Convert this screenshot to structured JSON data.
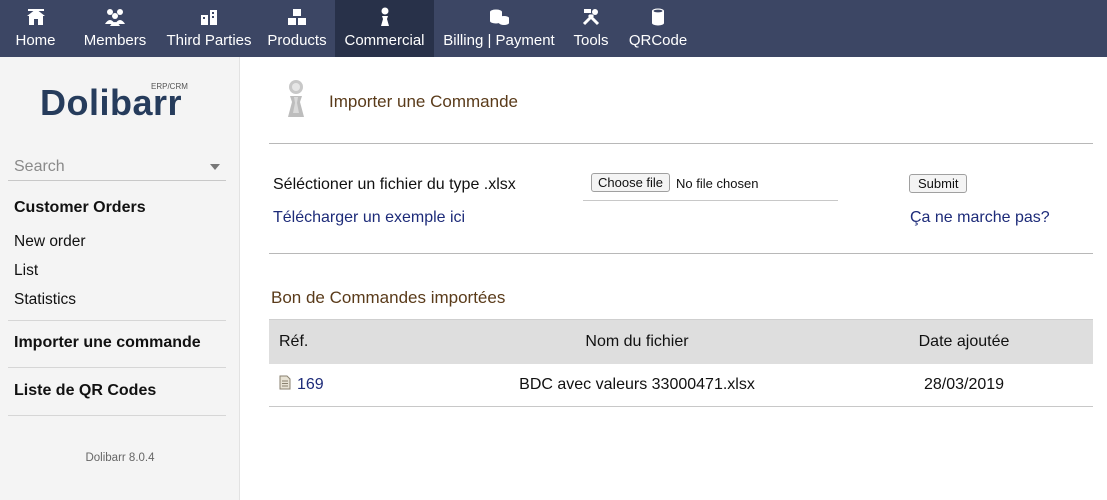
{
  "nav": {
    "items": [
      {
        "label": "Home",
        "icon": "home-icon"
      },
      {
        "label": "Members",
        "icon": "members-icon"
      },
      {
        "label": "Third Parties",
        "icon": "third-parties-icon"
      },
      {
        "label": "Products",
        "icon": "products-icon"
      },
      {
        "label": "Commercial",
        "icon": "commercial-icon",
        "active": true
      },
      {
        "label": "Billing | Payment",
        "icon": "billing-icon"
      },
      {
        "label": "Tools",
        "icon": "tools-icon"
      },
      {
        "label": "QRCode",
        "icon": "qrcode-icon"
      }
    ]
  },
  "sidebar": {
    "logo_text": "Dolibarr",
    "logo_sub": "ERP/CRM",
    "search_placeholder": "Search",
    "customer_orders_title": "Customer Orders",
    "links": [
      "New order",
      "List",
      "Statistics"
    ],
    "import_title": "Importer une commande",
    "qr_title": "Liste de QR Codes",
    "version": "Dolibarr 8.0.4"
  },
  "main": {
    "page_title": "Importer une Commande",
    "select_label": "Séléctioner un fichier du type .xlsx",
    "choose_file_label": "Choose file",
    "no_file_label": "No file chosen",
    "submit_label": "Submit",
    "download_link": "Télécharger un exemple ici",
    "help_link": "Ça ne marche pas?",
    "section_title": "Bon de Commandes importées",
    "table": {
      "headers": [
        "Réf.",
        "Nom du fichier",
        "Date ajoutée"
      ],
      "rows": [
        {
          "ref": "169",
          "file": "BDC avec valeurs 33000471.xlsx",
          "date": "28/03/2019"
        }
      ]
    }
  },
  "colors": {
    "nav_bg": "#3c4664",
    "nav_active_bg": "#283149",
    "title_brown": "#5a3b1a",
    "link_blue": "#1d2b79",
    "header_gray": "#dedede"
  }
}
